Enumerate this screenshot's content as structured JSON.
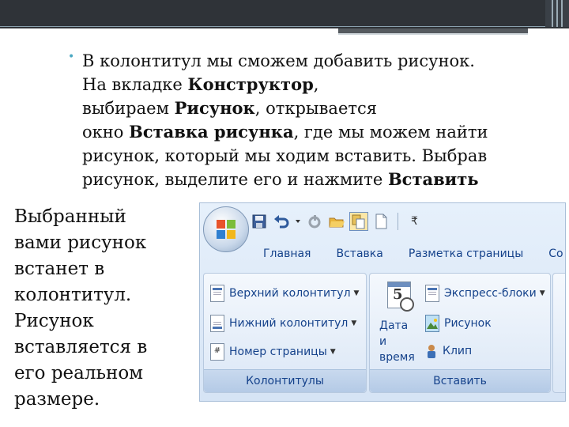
{
  "slide": {
    "paragraph_lines": [
      {
        "text": "В колонтитул мы сможем добавить рисунок."
      },
      {
        "pre": "На вкладке  ",
        "bold": "Конструктор",
        "post": ","
      },
      {
        "pre": "выбираем ",
        "bold": "Рисунок",
        "post": ", открывается"
      },
      {
        "pre": "окно ",
        "bold": "Вставка рисунка",
        "post": ", где мы можем найти"
      },
      {
        "text": "рисунок, который мы ходим вставить. Выбрав"
      },
      {
        "pre": "рисунок, выделите его и нажмите ",
        "bold": "Вставить",
        "post": ""
      }
    ],
    "side_lines": [
      "Выбранный",
      "вами рисунок",
      "встанет в",
      "колонтитул.",
      "Рисунок",
      "вставляется в",
      "его реальном",
      "размере."
    ]
  },
  "ribbon": {
    "quick_access_dropdown": "₹",
    "tabs": [
      "Главная",
      "Вставка",
      "Разметка страницы",
      "Co"
    ],
    "groups": {
      "headers_footers": {
        "title": "Колонтитулы",
        "header_label": "Верхний колонтитул",
        "footer_label": "Нижний колонтитул",
        "page_number_label": "Номер страницы"
      },
      "insert": {
        "title": "Вставить",
        "calendar_number": "5",
        "date_time_line1": "Дата и",
        "date_time_line2": "время",
        "quick_parts_label": "Экспресс-блоки",
        "picture_label": "Рисунок",
        "clip_label": "Клип"
      }
    }
  },
  "colors": {
    "bullet": "#4aa8c2",
    "ribbon_text": "#15428b",
    "top_bar": "#2f3338"
  }
}
